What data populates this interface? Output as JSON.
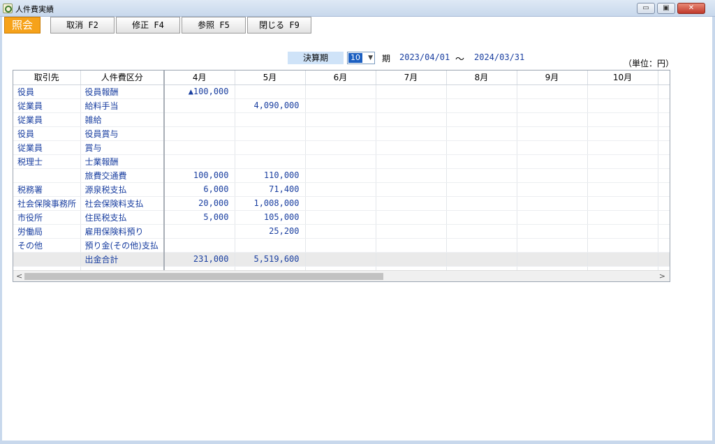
{
  "window": {
    "title": "人件費実績",
    "min": "▭",
    "max": "▣",
    "close": "✕"
  },
  "toolbar": {
    "mode": "照会",
    "cancel": "取消 F2",
    "edit": "修正 F4",
    "reference": "参照 F5",
    "close": "閉じる F9"
  },
  "period": {
    "label": "決算期",
    "value": "10",
    "suffix": "期",
    "from": "2023/04/01",
    "tilde": "～",
    "to": "2024/03/31",
    "unit": "（単位：円）"
  },
  "grid": {
    "headers": [
      "取引先",
      "人件費区分",
      "4月",
      "5月",
      "6月",
      "7月",
      "8月",
      "9月",
      "10月"
    ],
    "rows": [
      [
        "役員",
        "役員報酬",
        "▲100,000",
        "",
        "",
        "",
        "",
        "",
        ""
      ],
      [
        "従業員",
        "給料手当",
        "",
        "4,090,000",
        "",
        "",
        "",
        "",
        ""
      ],
      [
        "従業員",
        "雑給",
        "",
        "",
        "",
        "",
        "",
        "",
        ""
      ],
      [
        "役員",
        "役員賞与",
        "",
        "",
        "",
        "",
        "",
        "",
        ""
      ],
      [
        "従業員",
        "賞与",
        "",
        "",
        "",
        "",
        "",
        "",
        ""
      ],
      [
        "税理士",
        "士業報酬",
        "",
        "",
        "",
        "",
        "",
        "",
        ""
      ],
      [
        "",
        "旅費交通費",
        "100,000",
        "110,000",
        "",
        "",
        "",
        "",
        ""
      ],
      [
        "税務署",
        "源泉税支払",
        "6,000",
        "71,400",
        "",
        "",
        "",
        "",
        ""
      ],
      [
        "社会保険事務所",
        "社会保険料支払",
        "20,000",
        "1,008,000",
        "",
        "",
        "",
        "",
        ""
      ],
      [
        "市役所",
        "住民税支払",
        "5,000",
        "105,000",
        "",
        "",
        "",
        "",
        ""
      ],
      [
        "労働局",
        "雇用保険料預り",
        "",
        "25,200",
        "",
        "",
        "",
        "",
        ""
      ],
      [
        "その他",
        "預り金(その他)支払",
        "",
        "",
        "",
        "",
        "",
        "",
        ""
      ]
    ],
    "total": [
      "",
      "出金合計",
      "231,000",
      "5,519,600",
      "",
      "",
      "",
      "",
      ""
    ],
    "scroll_left": "<",
    "scroll_right": ">"
  }
}
